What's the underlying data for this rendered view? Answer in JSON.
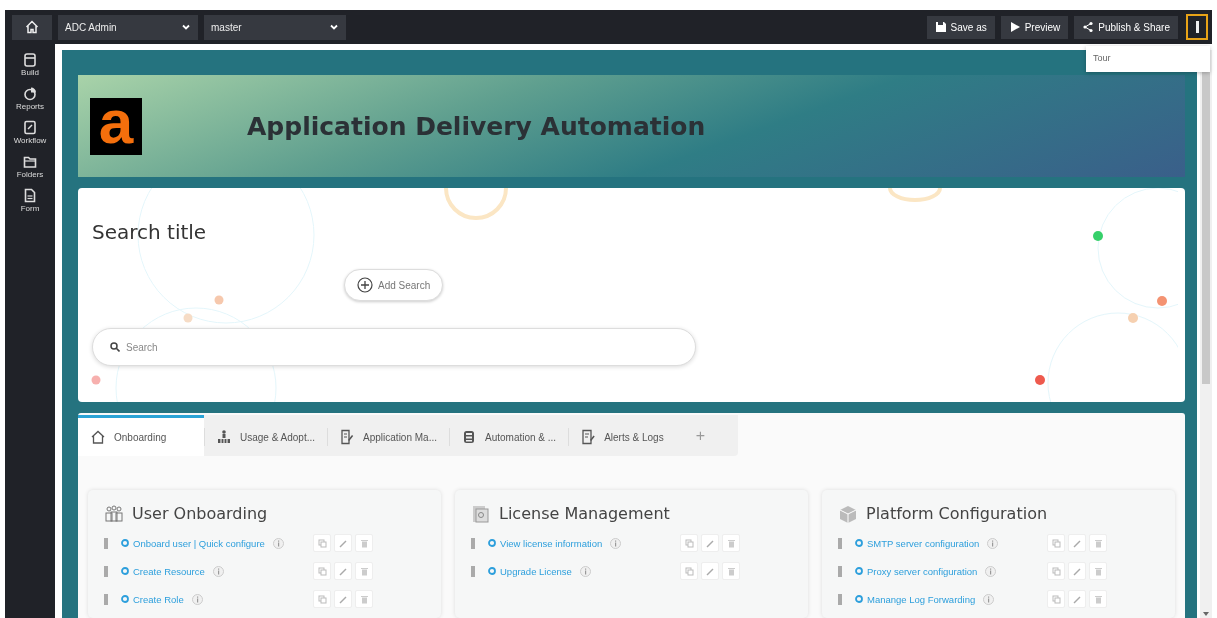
{
  "topbar": {
    "workspace_select": "ADC Admin",
    "branch_select": "master",
    "buttons": [
      {
        "kind": "save",
        "label": "Save as"
      },
      {
        "kind": "preview",
        "label": "Preview"
      },
      {
        "kind": "share",
        "label": "Publish & Share"
      }
    ]
  },
  "menu": {
    "open": true,
    "items": [
      "Tour"
    ]
  },
  "sidebar": {
    "items": [
      {
        "kind": "build",
        "label": "Build"
      },
      {
        "kind": "reports",
        "label": "Reports"
      },
      {
        "kind": "workflow",
        "label": "Workflow"
      },
      {
        "kind": "folders",
        "label": "Folders"
      },
      {
        "kind": "form",
        "label": "Form"
      }
    ]
  },
  "banner": {
    "logo": "a",
    "title": "Application Delivery Automation"
  },
  "search_card": {
    "title": "Search title",
    "add_button": "Add Search",
    "search": {
      "placeholder": "Search"
    }
  },
  "tabs": [
    {
      "kind": "home",
      "label": "Onboarding",
      "selected": true
    },
    {
      "kind": "usage",
      "label": "Usage & Adopt...",
      "selected": false
    },
    {
      "kind": "app",
      "label": "Application Ma...",
      "selected": false
    },
    {
      "kind": "automation",
      "label": "Automation & ...",
      "selected": false
    },
    {
      "kind": "alerts",
      "label": "Alerts & Logs",
      "selected": false
    }
  ],
  "add_tab": "+",
  "cards": [
    {
      "kind": "users",
      "title": "User Onboarding",
      "items": [
        "Onboard user | Quick configure",
        "Create Resource",
        "Create Role"
      ]
    },
    {
      "kind": "license",
      "title": "License Management",
      "items": [
        "View license information",
        "Upgrade License"
      ]
    },
    {
      "kind": "platform",
      "title": "Platform Configuration",
      "items": [
        "SMTP server configuration",
        "Proxy server configuration",
        "Manange Log Forwarding"
      ]
    }
  ]
}
